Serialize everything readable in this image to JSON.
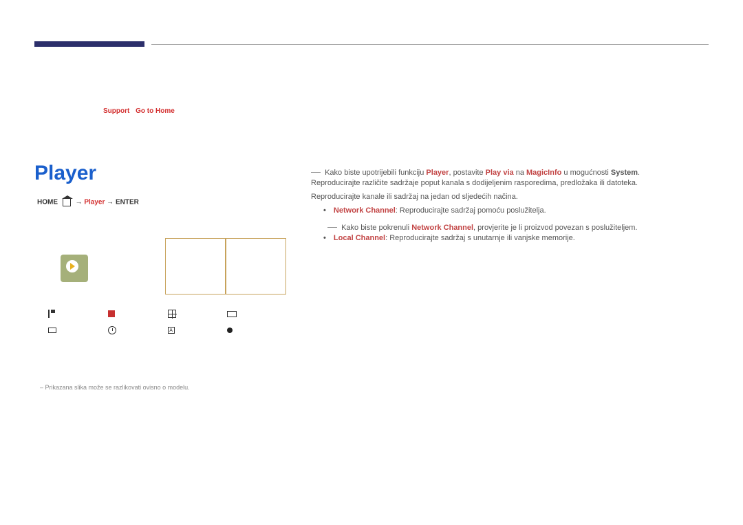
{
  "breadcrumb": {
    "first": "Support",
    "second": "Go to Home"
  },
  "title": "Player",
  "homepath": {
    "home": "HOME",
    "player": "Player",
    "enter": "ENTER"
  },
  "content": {
    "line1_pre": "Kako biste upotrijebili funkciju ",
    "line1_k1": "Player",
    "line1_mid1": ", postavite ",
    "line1_k2": "Play via",
    "line1_mid2": " na ",
    "line1_k3": "MagicInfo",
    "line1_mid3": " u mogućnosti ",
    "line1_k4": "System",
    "line1_end": ".",
    "line2": "Reproducirajte različite sadržaje poput kanala s dodijeljenim rasporedima, predložaka ili datoteka.",
    "line3": "Reproducirajte kanale ili sadržaj na jedan od sljedećih načina.",
    "nc_label": "Network Channel",
    "nc_text": ": Reproducirajte sadržaj pomoću poslužitelja.",
    "nc_note_pre": "Kako biste pokrenuli ",
    "nc_note_k": "Network Channel",
    "nc_note_post": ", provjerite je li proizvod povezan s poslužiteljem.",
    "lc_label": "Local Channel",
    "lc_text": ": Reproducirajte sadržaj s unutarnje ili vanjske memorije."
  },
  "footnote": "Prikazana slika može se razlikovati ovisno o modelu."
}
